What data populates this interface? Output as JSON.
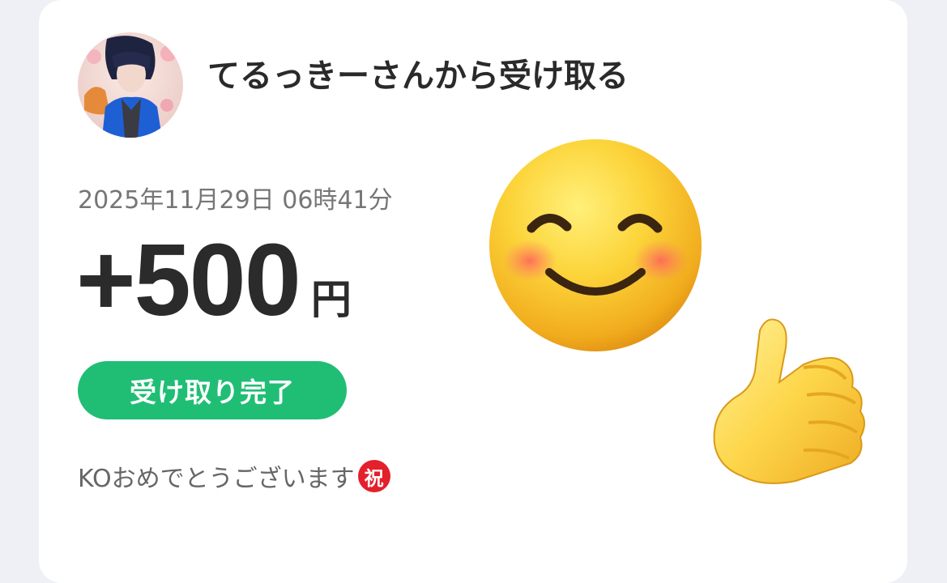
{
  "header": {
    "title": "てるっきーさんから受け取る",
    "avatar_icon": "user-avatar-illustration"
  },
  "transaction": {
    "timestamp": "2025年11月29日 06時41分",
    "amount": "+500",
    "currency_unit": "円",
    "status": "受け取り完了",
    "status_color": "#20be75"
  },
  "message": {
    "text": "KOおめでとうございます",
    "badge": "祝",
    "badge_color": "#e3202b"
  },
  "stickers": {
    "smile": "smiling-face-emoji",
    "thumbs": "thumbs-up-emoji"
  }
}
